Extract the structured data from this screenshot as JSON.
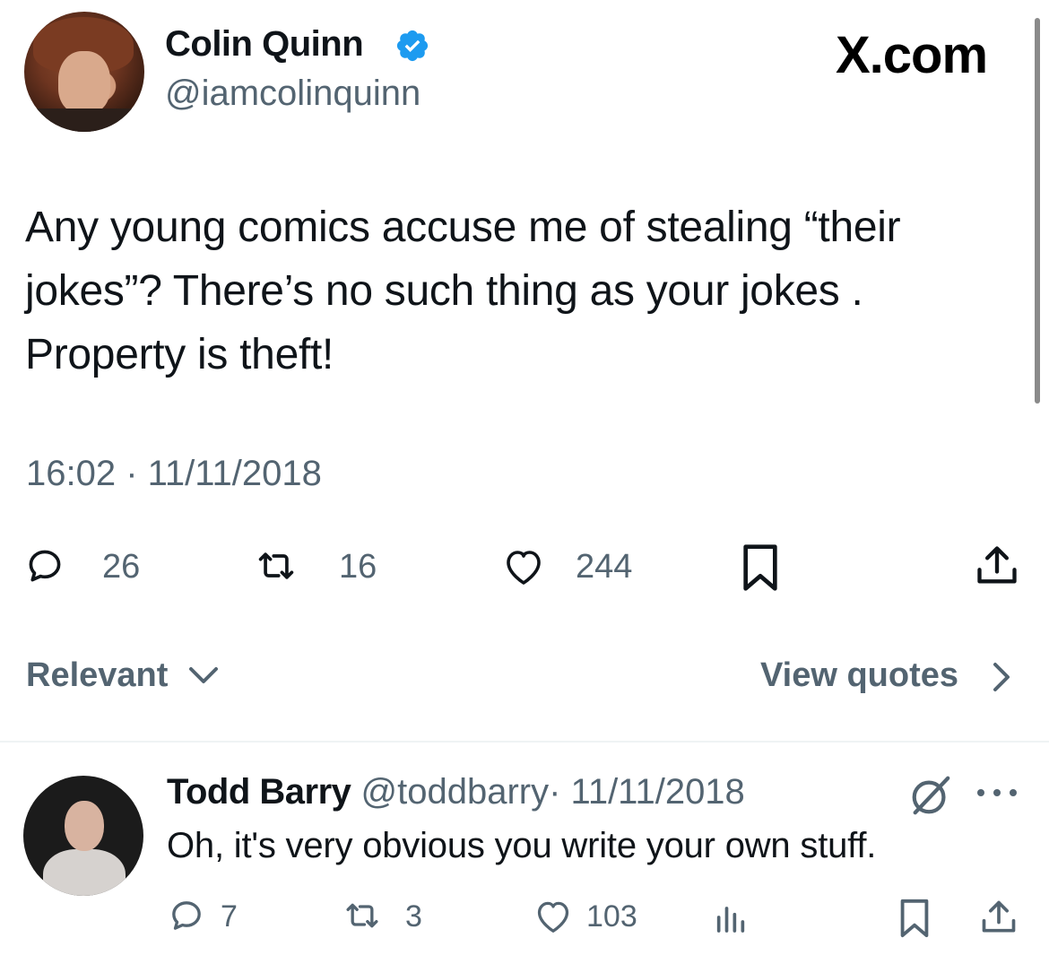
{
  "brand": "X.com",
  "tweet": {
    "author_name": "Colin Quinn",
    "author_handle": "@iamcolinquinn",
    "verified": true,
    "text": "Any young comics accuse me of stealing “their jokes”? There’s no such thing as your jokes . Property is theft!",
    "timestamp": "16:02 · 11/11/2018",
    "replies": "26",
    "reposts": "16",
    "likes": "244"
  },
  "sort": {
    "label": "Relevant",
    "view_quotes": "View quotes"
  },
  "reply": {
    "author_name": "Todd Barry",
    "author_handle": "@toddbarry",
    "date": "· 11/11/2018",
    "text": "Oh, it's very obvious you write your own stuff.",
    "replies": "7",
    "reposts": "3",
    "likes": "103"
  },
  "icons": {
    "reply": "reply-icon",
    "repost": "repost-icon",
    "like": "heart-icon",
    "bookmark": "bookmark-icon",
    "share": "share-icon",
    "views": "analytics-icon",
    "grok": "grok-icon",
    "more": "more-icon",
    "verified": "verified-badge-icon"
  },
  "colors": {
    "text": "#0f1419",
    "secondary": "#536471",
    "verified": "#1d9bf0"
  }
}
